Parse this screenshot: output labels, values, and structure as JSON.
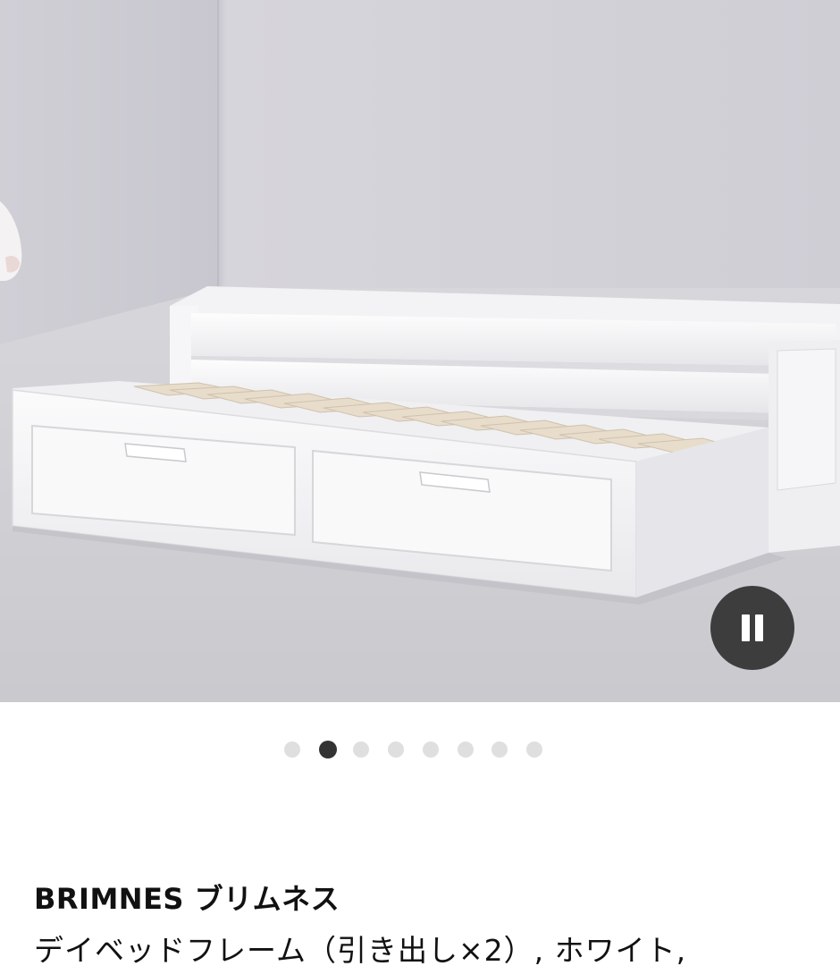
{
  "media": {
    "image_alt": "BRIMNES デイベッドフレーム",
    "pause_icon": "pause-icon",
    "pause_button_color": "#3d3d3d"
  },
  "carousel": {
    "dot_count": 8,
    "active_index": 1,
    "active_color": "#333333",
    "inactive_color": "#dfdfdf"
  },
  "product": {
    "name": "BRIMNES ブリムネス",
    "description": "デイベッドフレーム（引き出し×2）, ホワイト,"
  }
}
